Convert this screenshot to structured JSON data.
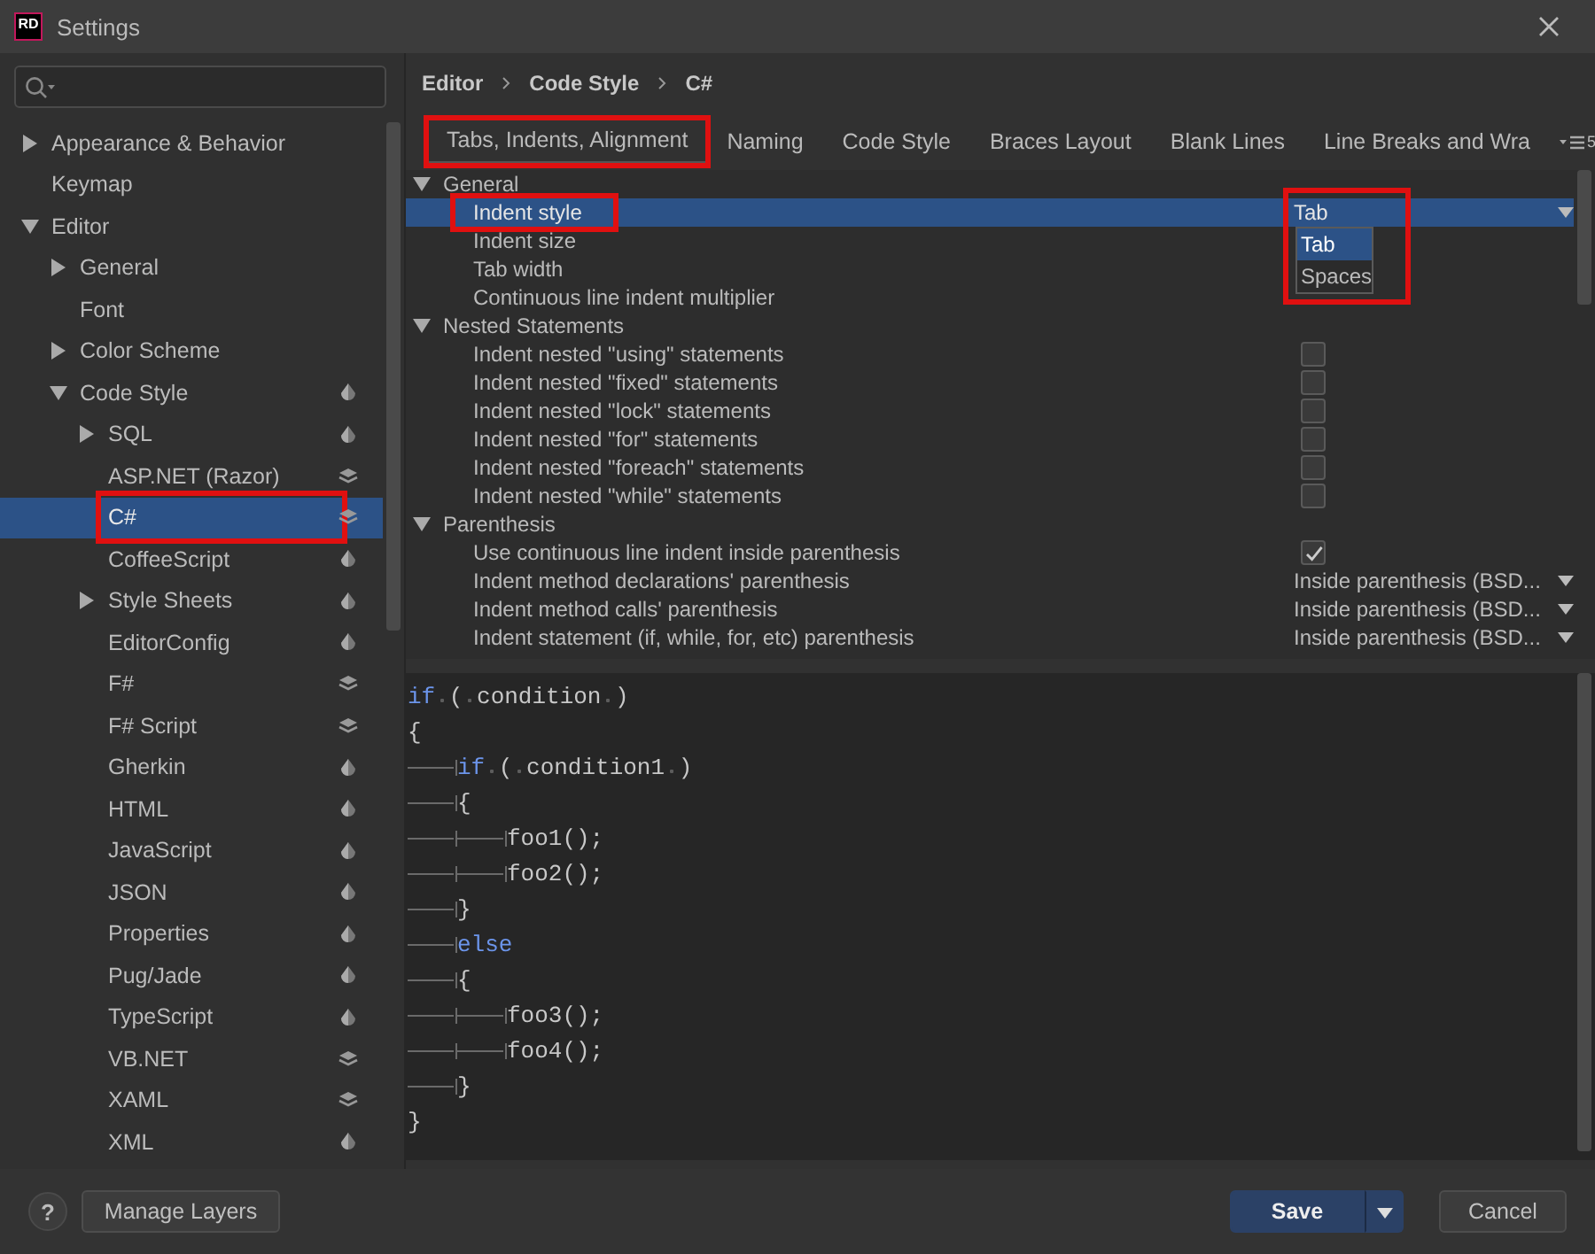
{
  "window": {
    "logo": "RD",
    "title": "Settings"
  },
  "sidebar": {
    "items": [
      {
        "label": "Appearance & Behavior",
        "expanded": false,
        "selected": false
      },
      {
        "label": "Keymap",
        "selected": false
      },
      {
        "label": "Editor",
        "expanded": true,
        "selected": false,
        "children": [
          {
            "label": "General",
            "expanded": false,
            "selected": false
          },
          {
            "label": "Font",
            "selected": false
          },
          {
            "label": "Color Scheme",
            "expanded": false,
            "selected": false
          },
          {
            "label": "Code Style",
            "expanded": true,
            "selected": false,
            "kind": "scheme",
            "children": [
              {
                "label": "SQL",
                "expanded": false,
                "selected": false,
                "kind": "scheme"
              },
              {
                "label": "ASP.NET (Razor)",
                "selected": false,
                "kind": "layers"
              },
              {
                "label": "C#",
                "selected": true,
                "highlighted": true,
                "kind": "layers"
              },
              {
                "label": "CoffeeScript",
                "selected": false,
                "kind": "scheme"
              },
              {
                "label": "Style Sheets",
                "expanded": false,
                "selected": false,
                "kind": "scheme"
              },
              {
                "label": "EditorConfig",
                "selected": false,
                "kind": "scheme"
              },
              {
                "label": "F#",
                "selected": false,
                "kind": "layers"
              },
              {
                "label": "F# Script",
                "selected": false,
                "kind": "layers"
              },
              {
                "label": "Gherkin",
                "selected": false,
                "kind": "scheme"
              },
              {
                "label": "HTML",
                "selected": false,
                "kind": "scheme"
              },
              {
                "label": "JavaScript",
                "selected": false,
                "kind": "scheme"
              },
              {
                "label": "JSON",
                "selected": false,
                "kind": "scheme"
              },
              {
                "label": "Properties",
                "selected": false,
                "kind": "scheme"
              },
              {
                "label": "Pug/Jade",
                "selected": false,
                "kind": "scheme"
              },
              {
                "label": "TypeScript",
                "selected": false,
                "kind": "scheme"
              },
              {
                "label": "VB.NET",
                "selected": false,
                "kind": "layers"
              },
              {
                "label": "XAML",
                "selected": false,
                "kind": "layers"
              },
              {
                "label": "XML",
                "selected": false,
                "kind": "scheme"
              }
            ]
          }
        ]
      }
    ]
  },
  "breadcrumb": [
    "Editor",
    "Code Style",
    "C#"
  ],
  "tabs": [
    {
      "label": "Tabs, Indents, Alignment",
      "selected": true,
      "highlighted": true
    },
    {
      "label": "Naming",
      "selected": false,
      "highlighted": false
    },
    {
      "label": "Code Style",
      "selected": false,
      "highlighted": false
    },
    {
      "label": "Braces Layout",
      "selected": false,
      "highlighted": false
    },
    {
      "label": "Blank Lines",
      "selected": false,
      "highlighted": false
    },
    {
      "label": "Line Breaks and Wra",
      "selected": false,
      "highlighted": false
    }
  ],
  "tab_overflow": {
    "count": "5"
  },
  "settings": {
    "sections": [
      {
        "title": "General",
        "expanded": true,
        "rows": [
          {
            "label": "Indent style",
            "kind": "dropdown",
            "value": "Tab",
            "selected": true,
            "highlighted": true,
            "popup": [
              {
                "label": "Tab",
                "selected": true
              },
              {
                "label": "Spaces",
                "selected": false
              }
            ]
          },
          {
            "label": "Indent size",
            "kind": "plain",
            "selected": false
          },
          {
            "label": "Tab width",
            "kind": "plain",
            "selected": false
          },
          {
            "label": "Continuous line indent multiplier",
            "kind": "plain",
            "selected": false
          }
        ]
      },
      {
        "title": "Nested Statements",
        "expanded": true,
        "rows": [
          {
            "label": "Indent nested \"using\" statements",
            "kind": "checkbox",
            "checked": false,
            "selected": false
          },
          {
            "label": "Indent nested \"fixed\" statements",
            "kind": "checkbox",
            "checked": false,
            "selected": false
          },
          {
            "label": "Indent nested \"lock\" statements",
            "kind": "checkbox",
            "checked": false,
            "selected": false
          },
          {
            "label": "Indent nested \"for\" statements",
            "kind": "checkbox",
            "checked": false,
            "selected": false
          },
          {
            "label": "Indent nested \"foreach\" statements",
            "kind": "checkbox",
            "checked": false,
            "selected": false
          },
          {
            "label": "Indent nested \"while\" statements",
            "kind": "checkbox",
            "checked": false,
            "selected": false
          }
        ]
      },
      {
        "title": "Parenthesis",
        "expanded": true,
        "rows": [
          {
            "label": "Use continuous line indent inside parenthesis",
            "kind": "checkbox",
            "checked": true,
            "selected": false
          },
          {
            "label": "Indent method declarations' parenthesis",
            "kind": "dropdown",
            "value": "Inside parenthesis (BSD...",
            "selected": false
          },
          {
            "label": "Indent method calls' parenthesis",
            "kind": "dropdown",
            "value": "Inside parenthesis (BSD...",
            "selected": false
          },
          {
            "label": "Indent statement (if, while, for, etc) parenthesis",
            "kind": "dropdown",
            "value": "Inside parenthesis (BSD...",
            "selected": false
          }
        ]
      }
    ]
  },
  "preview": {
    "lines": [
      [
        {
          "kind": "keyword",
          "text": "if"
        },
        {
          "kind": "space"
        },
        {
          "kind": "text",
          "text": "("
        },
        {
          "kind": "space"
        },
        {
          "kind": "text",
          "text": "condition"
        },
        {
          "kind": "space"
        },
        {
          "kind": "text",
          "text": ")"
        }
      ],
      [
        {
          "kind": "text",
          "text": "{"
        }
      ],
      [
        {
          "kind": "tab"
        },
        {
          "kind": "keyword",
          "text": "if"
        },
        {
          "kind": "space"
        },
        {
          "kind": "text",
          "text": "("
        },
        {
          "kind": "space"
        },
        {
          "kind": "text",
          "text": "condition1"
        },
        {
          "kind": "space"
        },
        {
          "kind": "text",
          "text": ")"
        }
      ],
      [
        {
          "kind": "tab"
        },
        {
          "kind": "text",
          "text": "{"
        }
      ],
      [
        {
          "kind": "tab"
        },
        {
          "kind": "tab"
        },
        {
          "kind": "text",
          "text": "foo1();"
        }
      ],
      [
        {
          "kind": "tab"
        },
        {
          "kind": "tab"
        },
        {
          "kind": "text",
          "text": "foo2();"
        }
      ],
      [
        {
          "kind": "tab"
        },
        {
          "kind": "text",
          "text": "}"
        }
      ],
      [
        {
          "kind": "tab"
        },
        {
          "kind": "keyword",
          "text": "else"
        }
      ],
      [
        {
          "kind": "tab"
        },
        {
          "kind": "text",
          "text": "{"
        }
      ],
      [
        {
          "kind": "tab"
        },
        {
          "kind": "tab"
        },
        {
          "kind": "text",
          "text": "foo3();"
        }
      ],
      [
        {
          "kind": "tab"
        },
        {
          "kind": "tab"
        },
        {
          "kind": "text",
          "text": "foo4();"
        }
      ],
      [
        {
          "kind": "tab"
        },
        {
          "kind": "text",
          "text": "}"
        }
      ],
      [
        {
          "kind": "text",
          "text": "}"
        }
      ]
    ]
  },
  "footer": {
    "help": "?",
    "manage": "Manage Layers",
    "save": "Save",
    "cancel": "Cancel"
  }
}
